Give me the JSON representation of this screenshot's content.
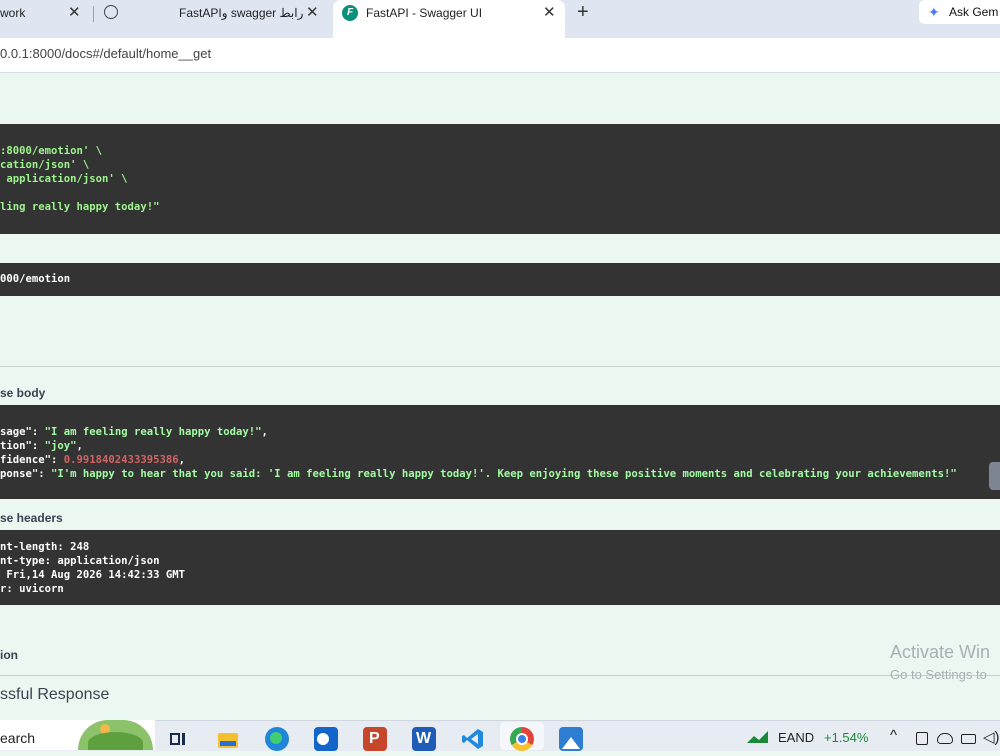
{
  "browser": {
    "tabs": [
      {
        "title": "work",
        "close": "✕"
      },
      {
        "title": "FastAPIو swagger رابط",
        "close": "✕"
      },
      {
        "title": "FastAPI - Swagger UI",
        "close": "✕"
      }
    ],
    "new_tab": "+",
    "ask_gemini": "Ask Gem",
    "address": "0.0.1:8000/docs#/default/home__get"
  },
  "curl": {
    "lines": [
      ":8000/emotion' \\",
      "cation/json' \\",
      " application/json' \\",
      "",
      "ling really happy today!\""
    ]
  },
  "request_url": "000/emotion",
  "response_body": {
    "heading": "se body",
    "lines": [
      [
        {
          "t": "sage\": ",
          "c": "wht"
        },
        {
          "t": "\"I am feeling really happy today!\"",
          "c": "str"
        },
        {
          "t": ",",
          "c": "wht"
        }
      ],
      [
        {
          "t": "tion\": ",
          "c": "wht"
        },
        {
          "t": "\"joy\"",
          "c": "str"
        },
        {
          "t": ",",
          "c": "wht"
        }
      ],
      [
        {
          "t": "fidence\": ",
          "c": "wht"
        },
        {
          "t": "0.9918402433395386",
          "c": "num"
        },
        {
          "t": ",",
          "c": "wht"
        }
      ],
      [
        {
          "t": "ponse\": ",
          "c": "wht"
        },
        {
          "t": "\"I'm happy to hear that you said: 'I am feeling really happy today!'. Keep enjoying these positive moments and celebrating your achievements!\"",
          "c": "str"
        }
      ]
    ]
  },
  "response_headers": {
    "heading": "se headers",
    "lines": [
      "nt-length: 248",
      "nt-type: application/json",
      " Fri,14 Aug 2026 14:42:33 GMT",
      "r: uvicorn"
    ]
  },
  "responses_table": {
    "description_heading": "ion",
    "successful_response": "ssful Response"
  },
  "watermark": {
    "line1": "Activate Win",
    "line2": "Go to Settings to"
  },
  "taskbar": {
    "search_label": "earch",
    "stock_name": "EAND",
    "stock_change": "+1.54%",
    "stock_change_color": "#1a8a3a"
  }
}
